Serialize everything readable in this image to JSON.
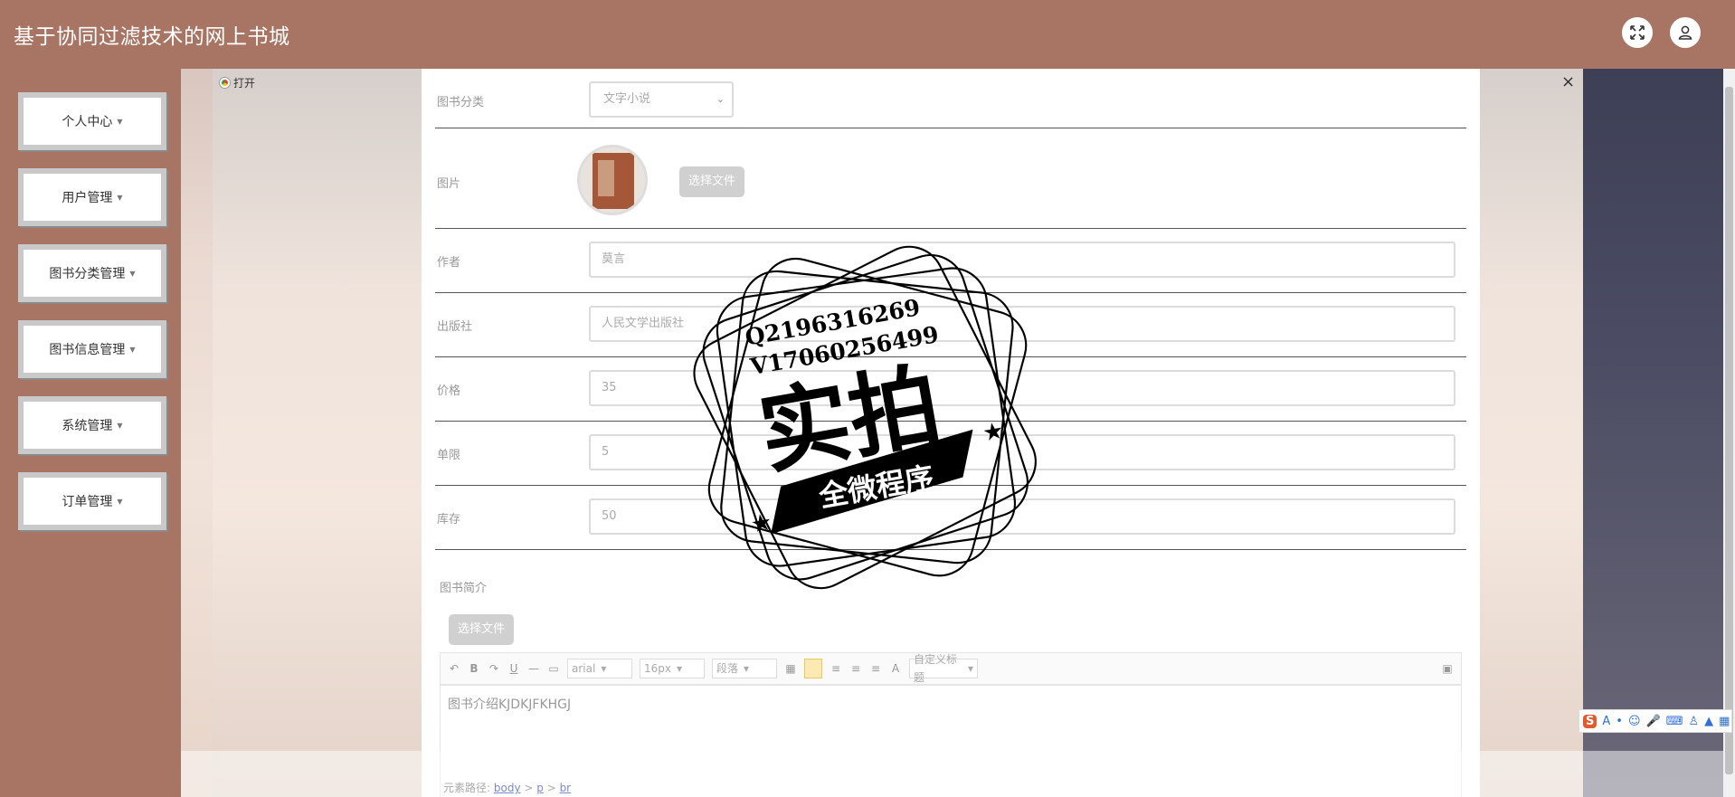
{
  "app": {
    "title": "基于协同过滤技术的网上书城"
  },
  "header_icons": {
    "fullscreen": "fullscreen-icon",
    "user": "user-icon"
  },
  "sidebar": {
    "items": [
      {
        "label": "个人中心"
      },
      {
        "label": "用户管理"
      },
      {
        "label": "图书分类管理"
      },
      {
        "label": "图书信息管理"
      },
      {
        "label": "系统管理"
      },
      {
        "label": "订单管理"
      }
    ]
  },
  "dialog": {
    "tab_label": "打开",
    "close_label": "×"
  },
  "form": {
    "category": {
      "label": "图书分类",
      "value": "文字小说"
    },
    "image": {
      "label": "图片",
      "button": "选择文件"
    },
    "author": {
      "label": "作者",
      "value": "莫言"
    },
    "publisher": {
      "label": "出版社",
      "value": "人民文学出版社"
    },
    "price": {
      "label": "价格",
      "value": "35"
    },
    "limit": {
      "label": "单限",
      "value": "5"
    },
    "stock": {
      "label": "库存",
      "value": "50"
    },
    "intro": {
      "label": "图书简介",
      "button": "选择文件"
    }
  },
  "editor": {
    "font_family": "arial",
    "font_size": "16px",
    "paragraph": "段落",
    "custom_title": "自定义标题",
    "content": "图书介绍KJDKJFKHGJ",
    "path_label": "元素路径:",
    "path_items": [
      "body",
      "p",
      "br"
    ]
  },
  "watermark": {
    "line1": "Q2196316269",
    "line2": "V17060256499",
    "big": "实拍",
    "banner": "全微程序"
  },
  "ime": {
    "logo": "S"
  }
}
